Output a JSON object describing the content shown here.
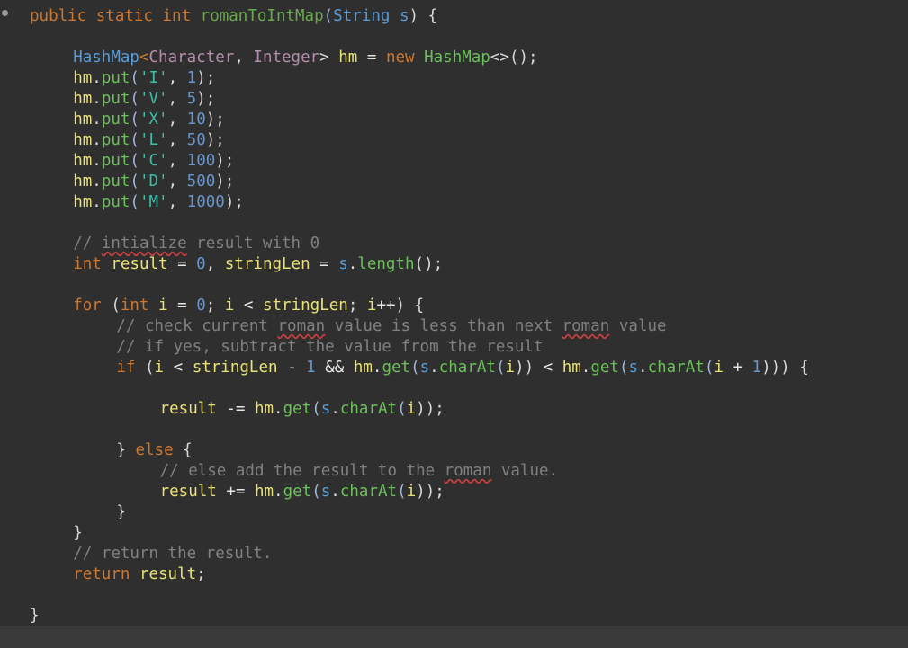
{
  "editor": {
    "lines": [
      {
        "row": 0,
        "indent": 0,
        "tokens": [
          {
            "t": "public static int ",
            "c": "kw"
          },
          {
            "t": "romanToIntMap",
            "c": "fn"
          },
          {
            "t": "(",
            "c": "par"
          },
          {
            "t": "String ",
            "c": "type"
          },
          {
            "t": "s",
            "c": "type"
          },
          {
            "t": ") {",
            "c": "pun"
          }
        ]
      },
      {
        "row": 2,
        "indent": 4,
        "tokens": [
          {
            "t": "HashMap",
            "c": "type"
          },
          {
            "t": "<",
            "c": "kw"
          },
          {
            "t": "Character",
            "c": "gen"
          },
          {
            "t": ", ",
            "c": "pun"
          },
          {
            "t": "Integer",
            "c": "gen"
          },
          {
            "t": "> ",
            "c": "pun"
          },
          {
            "t": "hm",
            "c": "id"
          },
          {
            "t": " = ",
            "c": "op"
          },
          {
            "t": "new ",
            "c": "kw"
          },
          {
            "t": "HashMap",
            "c": "m"
          },
          {
            "t": "<>",
            "c": "pun"
          },
          {
            "t": "();",
            "c": "pun"
          }
        ]
      },
      {
        "row": 3,
        "indent": 4,
        "tokens": [
          {
            "t": "hm",
            "c": "id"
          },
          {
            "t": ".",
            "c": "pun"
          },
          {
            "t": "put",
            "c": "m"
          },
          {
            "t": "(",
            "c": "par"
          },
          {
            "t": "'I'",
            "c": "str"
          },
          {
            "t": ", ",
            "c": "pun"
          },
          {
            "t": "1",
            "c": "num"
          },
          {
            "t": ");",
            "c": "pun"
          }
        ]
      },
      {
        "row": 4,
        "indent": 4,
        "tokens": [
          {
            "t": "hm",
            "c": "id"
          },
          {
            "t": ".",
            "c": "pun"
          },
          {
            "t": "put",
            "c": "m"
          },
          {
            "t": "(",
            "c": "par"
          },
          {
            "t": "'V'",
            "c": "str"
          },
          {
            "t": ", ",
            "c": "pun"
          },
          {
            "t": "5",
            "c": "num"
          },
          {
            "t": ");",
            "c": "pun"
          }
        ]
      },
      {
        "row": 5,
        "indent": 4,
        "tokens": [
          {
            "t": "hm",
            "c": "id"
          },
          {
            "t": ".",
            "c": "pun"
          },
          {
            "t": "put",
            "c": "m"
          },
          {
            "t": "(",
            "c": "par"
          },
          {
            "t": "'X'",
            "c": "str"
          },
          {
            "t": ", ",
            "c": "pun"
          },
          {
            "t": "10",
            "c": "num"
          },
          {
            "t": ");",
            "c": "pun"
          }
        ]
      },
      {
        "row": 6,
        "indent": 4,
        "tokens": [
          {
            "t": "hm",
            "c": "id"
          },
          {
            "t": ".",
            "c": "pun"
          },
          {
            "t": "put",
            "c": "m"
          },
          {
            "t": "(",
            "c": "par"
          },
          {
            "t": "'L'",
            "c": "str"
          },
          {
            "t": ", ",
            "c": "pun"
          },
          {
            "t": "50",
            "c": "num"
          },
          {
            "t": ");",
            "c": "pun"
          }
        ]
      },
      {
        "row": 7,
        "indent": 4,
        "tokens": [
          {
            "t": "hm",
            "c": "id"
          },
          {
            "t": ".",
            "c": "pun"
          },
          {
            "t": "put",
            "c": "m"
          },
          {
            "t": "(",
            "c": "par"
          },
          {
            "t": "'C'",
            "c": "str"
          },
          {
            "t": ", ",
            "c": "pun"
          },
          {
            "t": "100",
            "c": "num"
          },
          {
            "t": ");",
            "c": "pun"
          }
        ]
      },
      {
        "row": 8,
        "indent": 4,
        "tokens": [
          {
            "t": "hm",
            "c": "id"
          },
          {
            "t": ".",
            "c": "pun"
          },
          {
            "t": "put",
            "c": "m"
          },
          {
            "t": "(",
            "c": "par"
          },
          {
            "t": "'D'",
            "c": "str"
          },
          {
            "t": ", ",
            "c": "pun"
          },
          {
            "t": "500",
            "c": "num"
          },
          {
            "t": ");",
            "c": "pun"
          }
        ]
      },
      {
        "row": 9,
        "indent": 4,
        "tokens": [
          {
            "t": "hm",
            "c": "id"
          },
          {
            "t": ".",
            "c": "pun"
          },
          {
            "t": "put",
            "c": "m"
          },
          {
            "t": "(",
            "c": "par"
          },
          {
            "t": "'M'",
            "c": "str"
          },
          {
            "t": ", ",
            "c": "pun"
          },
          {
            "t": "1000",
            "c": "num"
          },
          {
            "t": ");",
            "c": "pun"
          }
        ]
      },
      {
        "row": 11,
        "indent": 4,
        "tokens": [
          {
            "t": "// ",
            "c": "cmt"
          },
          {
            "t": "intialize",
            "c": "cmt",
            "sq": true
          },
          {
            "t": " result with 0",
            "c": "cmt"
          }
        ]
      },
      {
        "row": 12,
        "indent": 4,
        "tokens": [
          {
            "t": "int ",
            "c": "kw"
          },
          {
            "t": "result",
            "c": "id"
          },
          {
            "t": " = ",
            "c": "op"
          },
          {
            "t": "0",
            "c": "num"
          },
          {
            "t": ", ",
            "c": "pun"
          },
          {
            "t": "stringLen",
            "c": "id"
          },
          {
            "t": " = ",
            "c": "op"
          },
          {
            "t": "s",
            "c": "type"
          },
          {
            "t": ".",
            "c": "pun"
          },
          {
            "t": "length",
            "c": "m"
          },
          {
            "t": "();",
            "c": "pun"
          }
        ]
      },
      {
        "row": 14,
        "indent": 4,
        "tokens": [
          {
            "t": "for ",
            "c": "kw"
          },
          {
            "t": "(",
            "c": "pun"
          },
          {
            "t": "int ",
            "c": "kw"
          },
          {
            "t": "i",
            "c": "id"
          },
          {
            "t": " = ",
            "c": "op"
          },
          {
            "t": "0",
            "c": "num"
          },
          {
            "t": "; ",
            "c": "pun"
          },
          {
            "t": "i",
            "c": "id"
          },
          {
            "t": " < ",
            "c": "op"
          },
          {
            "t": "stringLen",
            "c": "id"
          },
          {
            "t": "; ",
            "c": "pun"
          },
          {
            "t": "i",
            "c": "id"
          },
          {
            "t": "++",
            "c": "op"
          },
          {
            "t": ") {",
            "c": "pun"
          }
        ]
      },
      {
        "row": 15,
        "indent": 8,
        "tokens": [
          {
            "t": "// check current ",
            "c": "cmt"
          },
          {
            "t": "roman",
            "c": "cmt",
            "sq": true
          },
          {
            "t": " value is less than next ",
            "c": "cmt"
          },
          {
            "t": "roman",
            "c": "cmt",
            "sq": true
          },
          {
            "t": " value",
            "c": "cmt"
          }
        ]
      },
      {
        "row": 16,
        "indent": 8,
        "tokens": [
          {
            "t": "// if yes, subtract the value from the result",
            "c": "cmt"
          }
        ]
      },
      {
        "row": 17,
        "indent": 8,
        "tokens": [
          {
            "t": "if ",
            "c": "kw"
          },
          {
            "t": "(",
            "c": "pun"
          },
          {
            "t": "i",
            "c": "id"
          },
          {
            "t": " < ",
            "c": "op"
          },
          {
            "t": "stringLen",
            "c": "id"
          },
          {
            "t": " - ",
            "c": "op"
          },
          {
            "t": "1",
            "c": "num"
          },
          {
            "t": " && ",
            "c": "op"
          },
          {
            "t": "hm",
            "c": "id"
          },
          {
            "t": ".",
            "c": "pun"
          },
          {
            "t": "get",
            "c": "m"
          },
          {
            "t": "(",
            "c": "par"
          },
          {
            "t": "s",
            "c": "type"
          },
          {
            "t": ".",
            "c": "pun"
          },
          {
            "t": "charAt",
            "c": "m"
          },
          {
            "t": "(",
            "c": "par"
          },
          {
            "t": "i",
            "c": "id"
          },
          {
            "t": "))",
            "c": "pun"
          },
          {
            "t": " < ",
            "c": "op"
          },
          {
            "t": "hm",
            "c": "id"
          },
          {
            "t": ".",
            "c": "pun"
          },
          {
            "t": "get",
            "c": "m"
          },
          {
            "t": "(",
            "c": "par"
          },
          {
            "t": "s",
            "c": "type"
          },
          {
            "t": ".",
            "c": "pun"
          },
          {
            "t": "charAt",
            "c": "m"
          },
          {
            "t": "(",
            "c": "par"
          },
          {
            "t": "i",
            "c": "id"
          },
          {
            "t": " + ",
            "c": "op"
          },
          {
            "t": "1",
            "c": "num"
          },
          {
            "t": "))) {",
            "c": "pun"
          }
        ]
      },
      {
        "row": 19,
        "indent": 12,
        "tokens": [
          {
            "t": "result",
            "c": "id"
          },
          {
            "t": " -= ",
            "c": "op"
          },
          {
            "t": "hm",
            "c": "id"
          },
          {
            "t": ".",
            "c": "pun"
          },
          {
            "t": "get",
            "c": "m"
          },
          {
            "t": "(",
            "c": "par"
          },
          {
            "t": "s",
            "c": "type"
          },
          {
            "t": ".",
            "c": "pun"
          },
          {
            "t": "charAt",
            "c": "m"
          },
          {
            "t": "(",
            "c": "par"
          },
          {
            "t": "i",
            "c": "id"
          },
          {
            "t": "));",
            "c": "pun"
          }
        ]
      },
      {
        "row": 21,
        "indent": 8,
        "tokens": [
          {
            "t": "} ",
            "c": "pun"
          },
          {
            "t": "else ",
            "c": "kw"
          },
          {
            "t": "{",
            "c": "pun"
          }
        ]
      },
      {
        "row": 22,
        "indent": 12,
        "tokens": [
          {
            "t": "// else add the result to the ",
            "c": "cmt"
          },
          {
            "t": "roman",
            "c": "cmt",
            "sq": true
          },
          {
            "t": " value.",
            "c": "cmt"
          }
        ]
      },
      {
        "row": 23,
        "indent": 12,
        "tokens": [
          {
            "t": "result",
            "c": "id"
          },
          {
            "t": " += ",
            "c": "op"
          },
          {
            "t": "hm",
            "c": "id"
          },
          {
            "t": ".",
            "c": "pun"
          },
          {
            "t": "get",
            "c": "m"
          },
          {
            "t": "(",
            "c": "par"
          },
          {
            "t": "s",
            "c": "type"
          },
          {
            "t": ".",
            "c": "pun"
          },
          {
            "t": "charAt",
            "c": "m"
          },
          {
            "t": "(",
            "c": "par"
          },
          {
            "t": "i",
            "c": "id"
          },
          {
            "t": "));",
            "c": "pun"
          }
        ]
      },
      {
        "row": 24,
        "indent": 8,
        "tokens": [
          {
            "t": "}",
            "c": "pun"
          }
        ]
      },
      {
        "row": 25,
        "indent": 4,
        "tokens": [
          {
            "t": "}",
            "c": "pun"
          }
        ]
      },
      {
        "row": 26,
        "indent": 4,
        "tokens": [
          {
            "t": "// return the result.",
            "c": "cmt"
          }
        ]
      },
      {
        "row": 27,
        "indent": 4,
        "tokens": [
          {
            "t": "return ",
            "c": "kw"
          },
          {
            "t": "result",
            "c": "id"
          },
          {
            "t": ";",
            "c": "pun"
          }
        ]
      },
      {
        "row": 29,
        "indent": 0,
        "tokens": [
          {
            "t": "}",
            "c": "pun"
          }
        ]
      }
    ]
  }
}
